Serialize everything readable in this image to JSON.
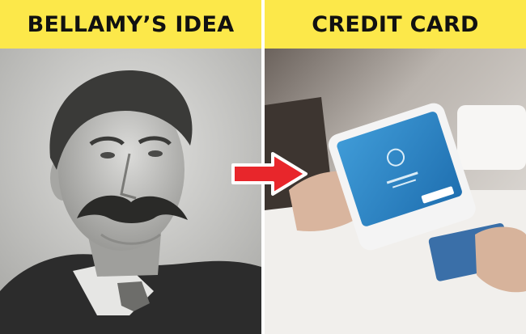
{
  "panels": {
    "left": {
      "title": "BELLAMY’S IDEA"
    },
    "right": {
      "title": "CREDIT CARD"
    }
  },
  "colors": {
    "banner": "#fce84a",
    "arrow": "#e8262b",
    "text": "#111111"
  },
  "icons": {
    "transition": "right-arrow-icon"
  }
}
